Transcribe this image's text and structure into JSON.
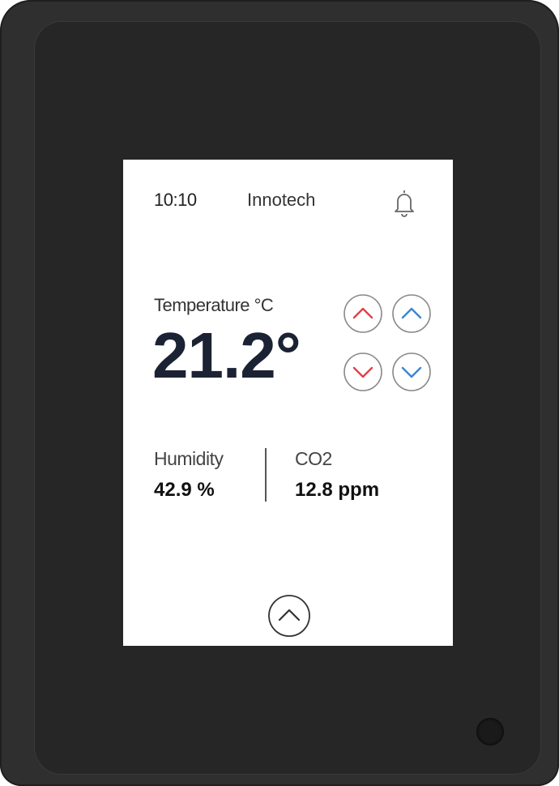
{
  "status_bar": {
    "time": "10:10",
    "brand": "Innotech",
    "bell_icon": "bell-icon"
  },
  "temperature": {
    "label": "Temperature °C",
    "value": "21.2°",
    "heat_color": "#e0414b",
    "cool_color": "#3b86d1"
  },
  "stats": {
    "humidity_label": "Humidity",
    "humidity_value": "42.9 %",
    "co2_label": "CO2",
    "co2_value": "12.8 ppm"
  },
  "navigation": {
    "expand_icon": "chevron-up-icon"
  }
}
